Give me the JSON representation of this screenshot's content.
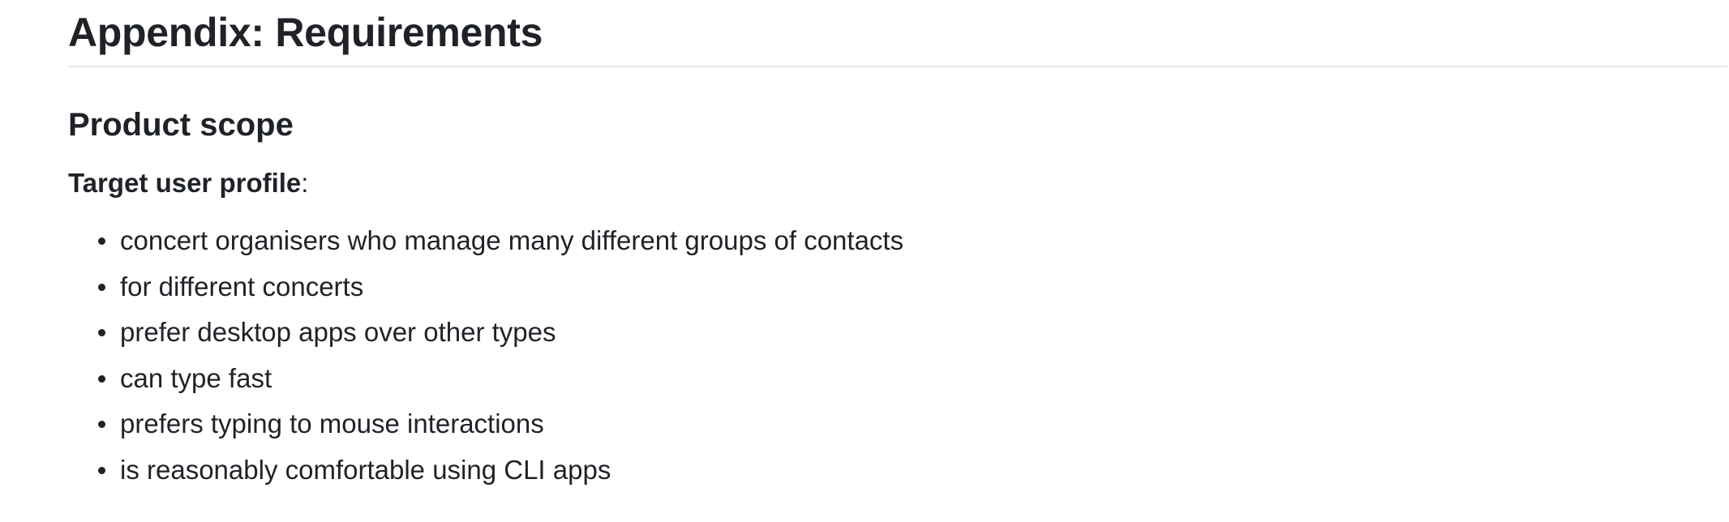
{
  "document": {
    "heading": "Appendix: Requirements",
    "section_title": "Product scope",
    "profile_label": "Target user profile",
    "profile_suffix": ":",
    "profile_items": [
      "concert organisers who manage many different groups of contacts",
      "for different concerts",
      "prefer desktop apps over other types",
      "can type fast",
      "prefers typing to mouse interactions",
      "is reasonably comfortable using CLI apps"
    ]
  },
  "colors": {
    "text": "#1f2328",
    "rule": "#e4e6ea",
    "background": "#ffffff"
  }
}
